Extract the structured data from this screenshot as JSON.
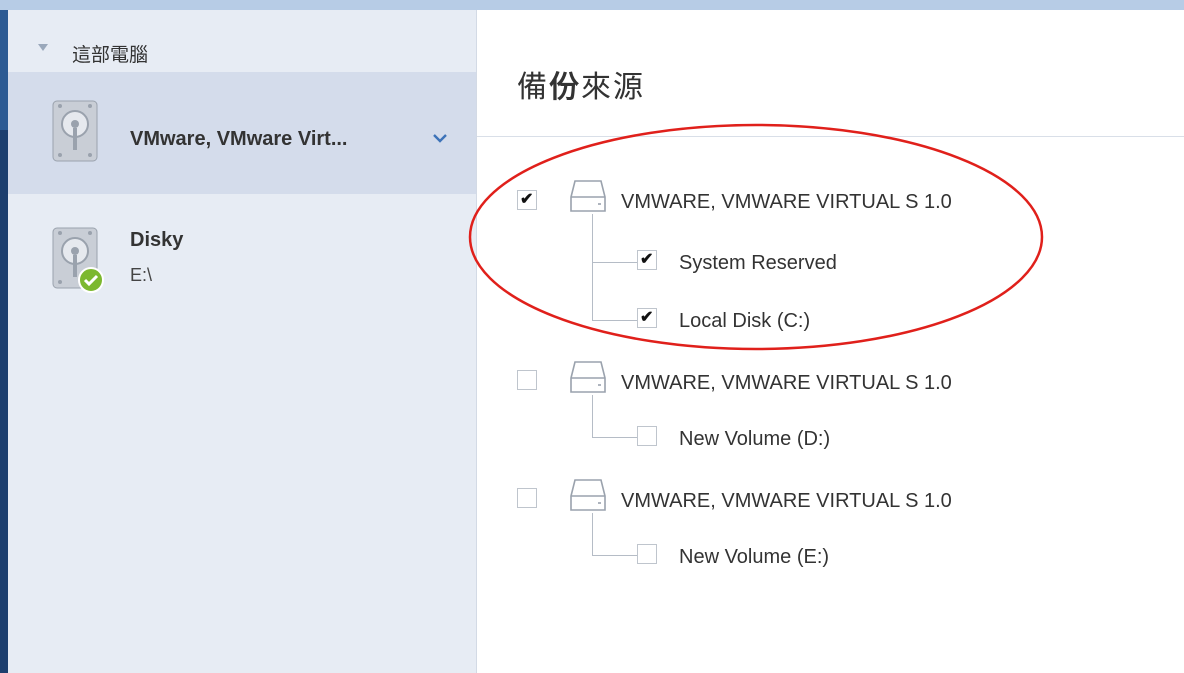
{
  "sidebar": {
    "tree_title": "這部電腦",
    "sources": [
      {
        "name": "VMware, VMware Virt...",
        "sub": "",
        "selected": true,
        "icon": "hard-drive-icon"
      },
      {
        "name": "Disky",
        "sub": "E:\\",
        "selected": false,
        "icon": "hard-drive-icon",
        "status": "ok-check-icon"
      }
    ]
  },
  "main": {
    "title_pre": "備",
    "title_bold": "份",
    "title_post": "來源",
    "disks": [
      {
        "label": "VMWARE, VMWARE VIRTUAL S 1.0",
        "checked": true,
        "volumes": [
          {
            "label": "System Reserved",
            "checked": true
          },
          {
            "label": "Local Disk (C:)",
            "checked": true
          }
        ]
      },
      {
        "label": "VMWARE, VMWARE VIRTUAL S 1.0",
        "checked": false,
        "volumes": [
          {
            "label": "New Volume (D:)",
            "checked": false
          }
        ]
      },
      {
        "label": "VMWARE, VMWARE VIRTUAL S 1.0",
        "checked": false,
        "volumes": [
          {
            "label": "New Volume (E:)",
            "checked": false
          }
        ]
      }
    ]
  },
  "colors": {
    "sidebar_bg": "#e7ecf4",
    "selected_bg": "#d4dceb",
    "annotation_red": "#e0201b",
    "status_green": "#7cb82f"
  }
}
